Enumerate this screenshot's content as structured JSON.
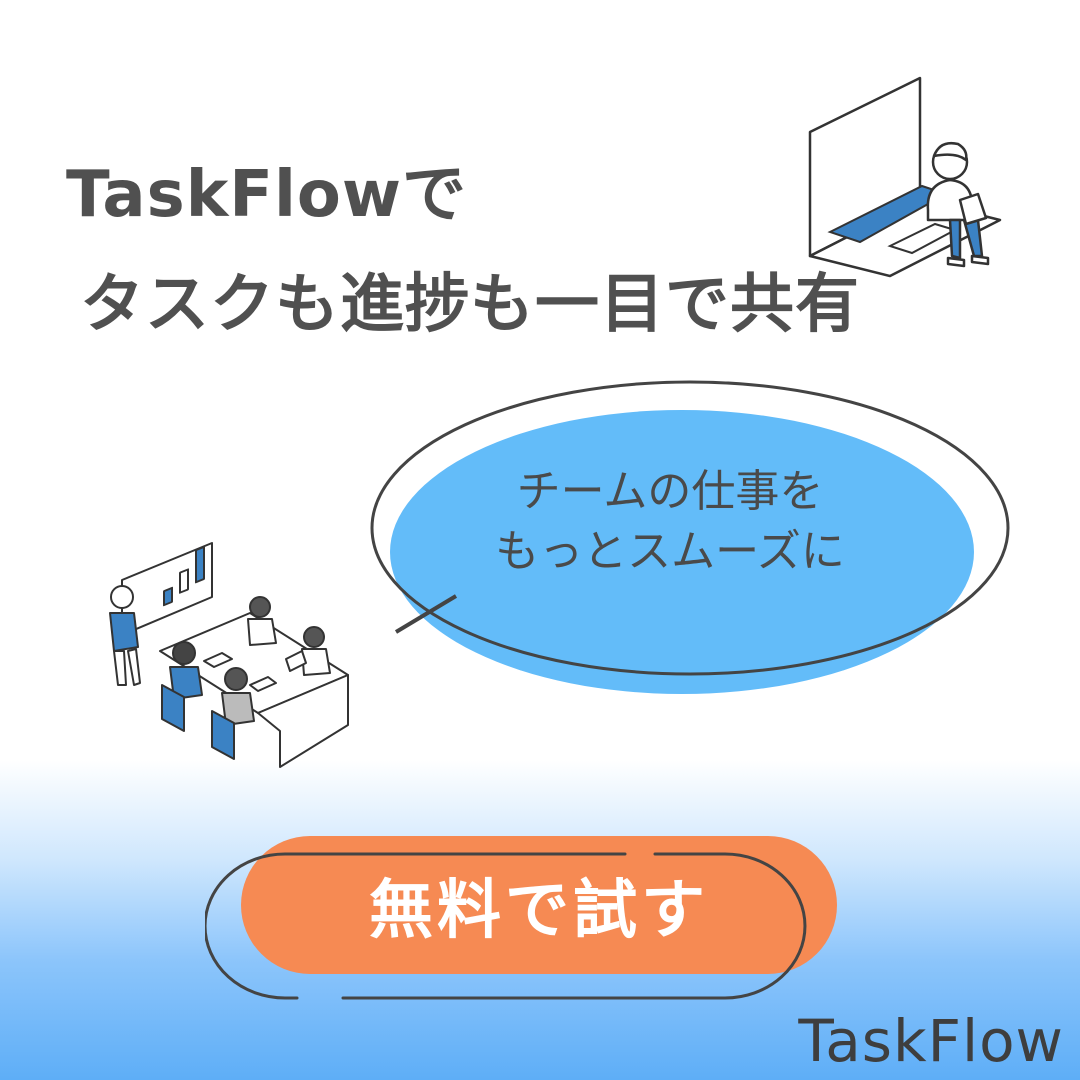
{
  "headline": {
    "line1": "TaskFlowで",
    "line2": "タスクも進捗も一目で共有"
  },
  "bubble": {
    "line1": "チームの仕事を",
    "line2": "もっとスムーズに"
  },
  "cta": {
    "label": "無料で試す"
  },
  "brand": "TaskFlow",
  "colors": {
    "headline_text": "#505050",
    "bubble_fill": "#63bcf9",
    "bubble_outline": "#444444",
    "cta_fill": "#f68a53",
    "cta_text": "#ffffff",
    "accent_blue": "#3b82c4",
    "background_gradient_bottom": "#5eaef7"
  },
  "icons": [
    "laptop-person-illustration",
    "team-meeting-illustration"
  ]
}
